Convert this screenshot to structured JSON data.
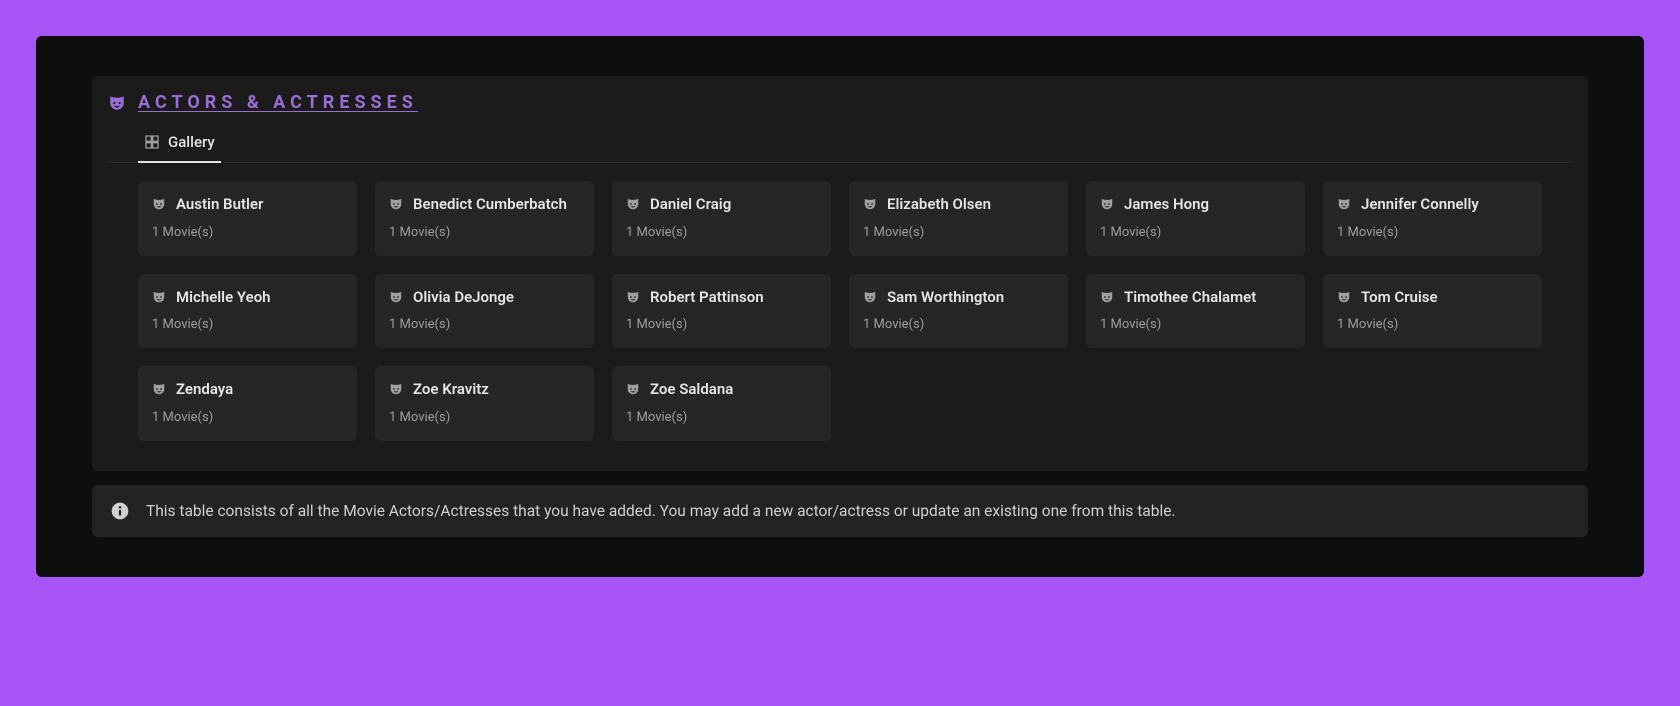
{
  "header": {
    "title": "ACTORS & ACTRESSES"
  },
  "tabs": {
    "gallery_label": "Gallery"
  },
  "actors": [
    {
      "name": "Austin Butler",
      "count": "1 Movie(s)"
    },
    {
      "name": "Benedict Cumberbatch",
      "count": "1 Movie(s)"
    },
    {
      "name": "Daniel Craig",
      "count": "1 Movie(s)"
    },
    {
      "name": "Elizabeth Olsen",
      "count": "1 Movie(s)"
    },
    {
      "name": "James Hong",
      "count": "1 Movie(s)"
    },
    {
      "name": "Jennifer Connelly",
      "count": "1 Movie(s)"
    },
    {
      "name": "Michelle Yeoh",
      "count": "1 Movie(s)"
    },
    {
      "name": "Olivia DeJonge",
      "count": "1 Movie(s)"
    },
    {
      "name": "Robert Pattinson",
      "count": "1 Movie(s)"
    },
    {
      "name": "Sam Worthington",
      "count": "1 Movie(s)"
    },
    {
      "name": "Timothee Chalamet",
      "count": "1 Movie(s)"
    },
    {
      "name": "Tom Cruise",
      "count": "1 Movie(s)"
    },
    {
      "name": "Zendaya",
      "count": "1 Movie(s)"
    },
    {
      "name": "Zoe Kravitz",
      "count": "1 Movie(s)"
    },
    {
      "name": "Zoe Saldana",
      "count": "1 Movie(s)"
    }
  ],
  "info": {
    "text": "This table consists of all the Movie Actors/Actresses that you have added. You may add a new actor/actress or update an existing one from this table."
  }
}
